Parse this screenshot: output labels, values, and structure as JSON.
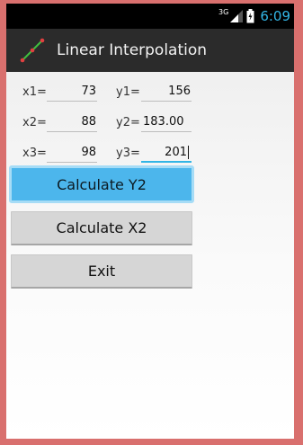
{
  "status_bar": {
    "network": "3G",
    "time": "6:09"
  },
  "app": {
    "title": "Linear Interpolation"
  },
  "fields": [
    {
      "x_label": "x1=",
      "x_value": "73",
      "y_label": "y1=",
      "y_value": "156"
    },
    {
      "x_label": "x2=",
      "x_value": "88",
      "y_label": "y2=",
      "y_value": "183.00"
    },
    {
      "x_label": "x3=",
      "x_value": "98",
      "y_label": "y3=",
      "y_value": "201"
    }
  ],
  "buttons": {
    "calc_y2": "Calculate Y2",
    "calc_x2": "Calculate X2",
    "exit": "Exit"
  },
  "colors": {
    "accent": "#33b5e5",
    "primary_button": "#4cb6ec",
    "window_border": "#d9706e"
  }
}
